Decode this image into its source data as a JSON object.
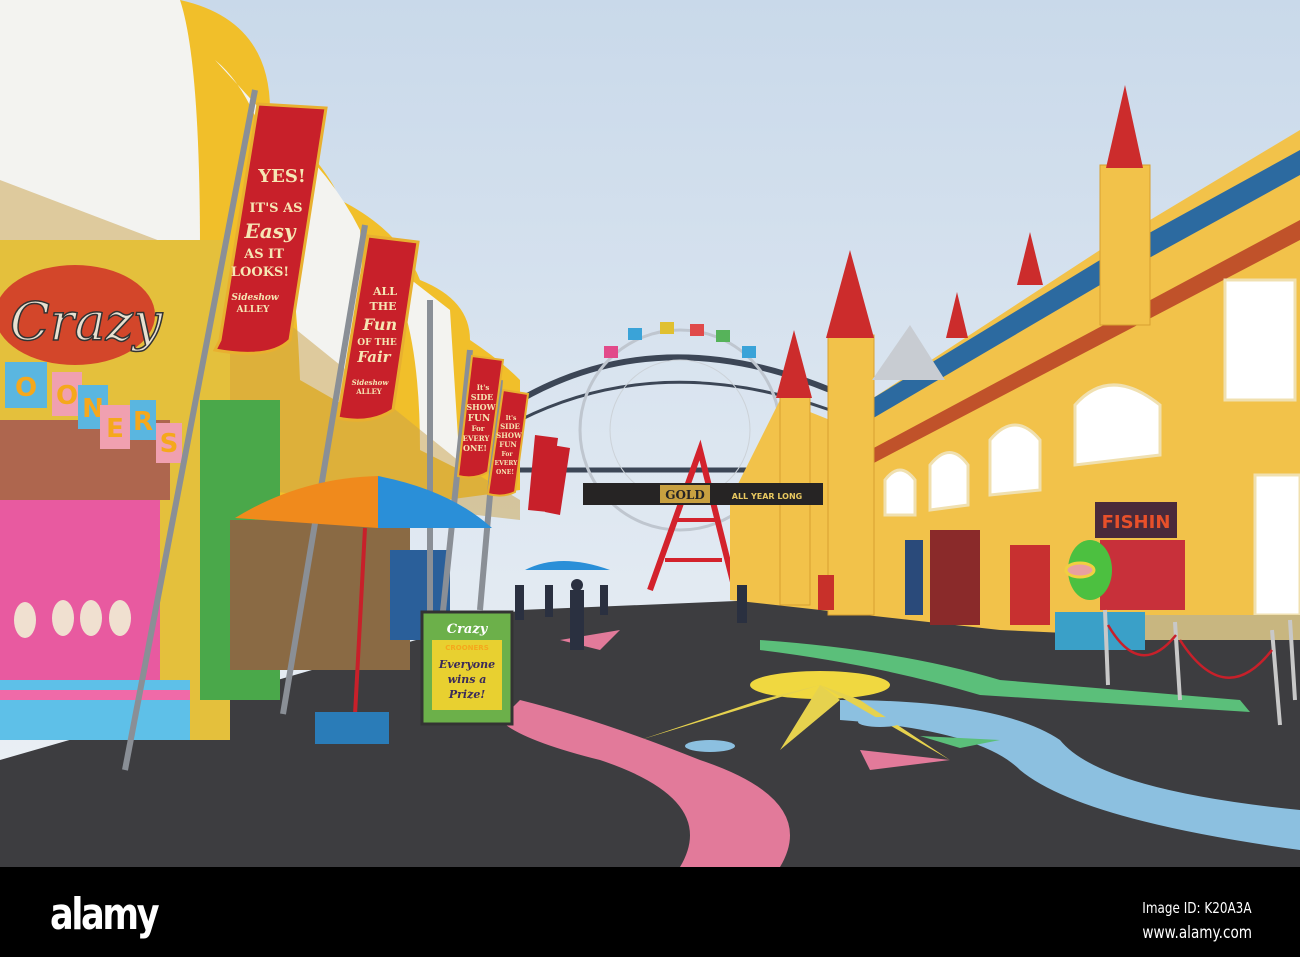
{
  "banners": [
    {
      "lines": [
        "YES!",
        "IT'S AS",
        "Easy",
        "AS IT",
        "LOOKS!"
      ],
      "footer": [
        "Sideshow",
        "ALLEY"
      ]
    },
    {
      "lines": [
        "ALL",
        "THE",
        "Fun",
        "OF THE",
        "Fair"
      ],
      "footer": [
        "Sideshow",
        "ALLEY"
      ]
    },
    {
      "lines": [
        "It's",
        "SIDE",
        "SHOW",
        "FUN",
        "For",
        "EVERY",
        "ONE!"
      ]
    },
    {
      "lines": [
        "It's",
        "SIDE",
        "SHOW",
        "FUN",
        "For",
        "EVERY",
        "ONE!"
      ]
    }
  ],
  "shop_sign": {
    "script": "Crazy",
    "letters": [
      "O",
      "O",
      "N",
      "E",
      "R",
      "S"
    ]
  },
  "a_frame_sign": {
    "title": "Crazy",
    "subtitle": "CROONERS",
    "lines": [
      "Everyone",
      "wins a",
      "Prize!"
    ]
  },
  "gold_banner": {
    "left": "GOLD",
    "right": "ALL YEAR LONG"
  },
  "fishing_sign": "FISHIN",
  "watermark": {
    "logo": "alamy",
    "image_id": "Image ID: K20A3A",
    "url": "www.alamy.com"
  },
  "colors": {
    "sky": "#dfe8f1",
    "castle": "#f2c24a",
    "ground": "#3b3b3d",
    "banner": "#c8202a"
  }
}
